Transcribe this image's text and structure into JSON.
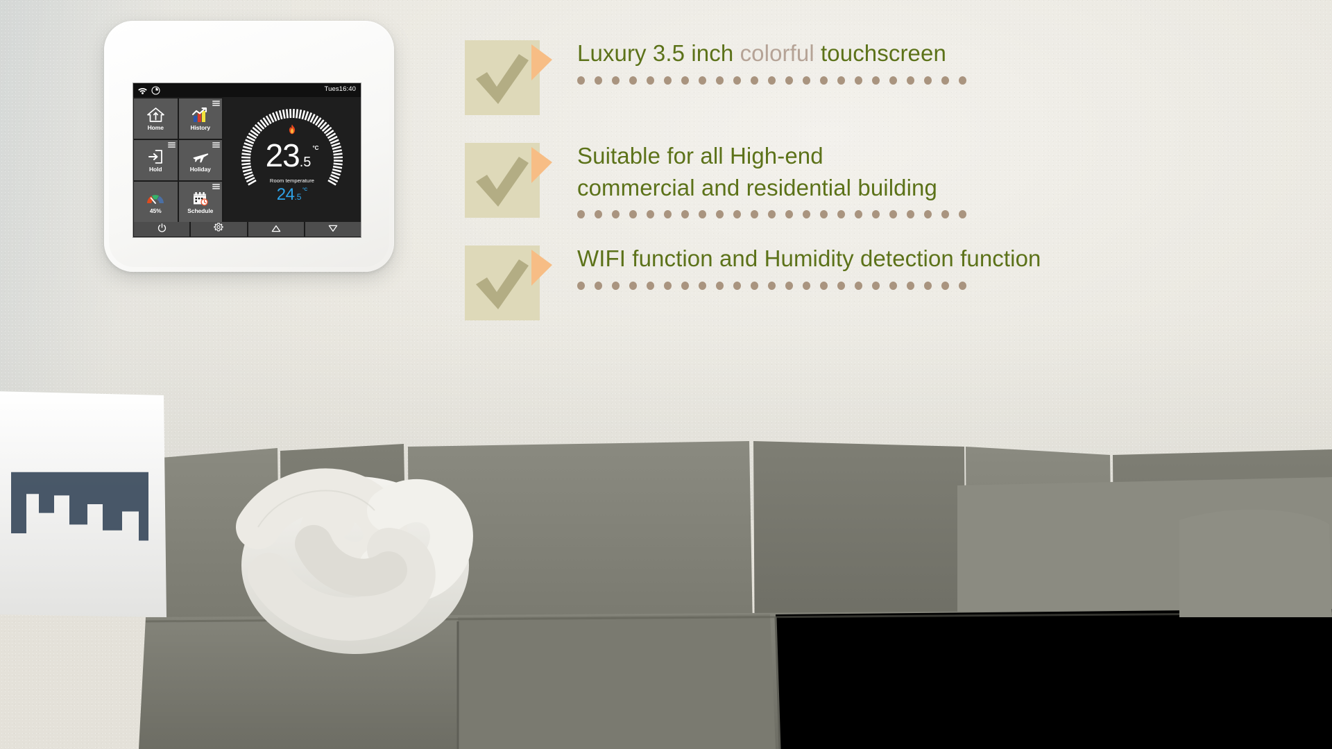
{
  "device": {
    "status_bar": {
      "wifi_icon": "wifi-icon",
      "clock_icon": "clock-icon",
      "time": "Tues16:40"
    },
    "tiles": [
      {
        "label": "Home",
        "icon": "house-arrow-icon",
        "has_menu": false
      },
      {
        "label": "History",
        "icon": "bar-chart-icon",
        "has_menu": true
      },
      {
        "label": "Hold",
        "icon": "login-arrow-icon",
        "has_menu": true
      },
      {
        "label": "Holiday",
        "icon": "airplane-icon",
        "has_menu": true
      },
      {
        "label": "45%",
        "icon": "humidity-gauge-icon",
        "has_menu": false
      },
      {
        "label": "Schedule",
        "icon": "calendar-clock-icon",
        "has_menu": true
      }
    ],
    "dial": {
      "flame_icon": "flame-icon",
      "room_temp_whole": "23",
      "room_temp_decimal": ".5",
      "room_temp_unit": "°C",
      "caption": "Room temperature",
      "set_temp_whole": "24",
      "set_temp_decimal": ".5",
      "set_temp_unit": "°C",
      "set_temp_color": "#2ea3e8",
      "tick_count": 60
    },
    "bottom_buttons": [
      {
        "icon": "power-icon"
      },
      {
        "icon": "gear-icon"
      },
      {
        "icon": "triangle-up-icon"
      },
      {
        "icon": "triangle-down-icon"
      }
    ]
  },
  "features": [
    {
      "check_icon": "check-mark-icon",
      "text_before": "Luxury 3.5 inch ",
      "text_highlight": "colorful",
      "text_after": " touchscreen",
      "text_line2": "",
      "dot_count": 23
    },
    {
      "check_icon": "check-mark-icon",
      "text_before": "Suitable for all High-end",
      "text_highlight": "",
      "text_after": "",
      "text_line2": "commercial and residential building",
      "dot_count": 23
    },
    {
      "check_icon": "check-mark-icon",
      "text_before": "WIFI function and Humidity detection function",
      "text_highlight": "",
      "text_after": "",
      "text_line2": "",
      "dot_count": 23
    }
  ],
  "colors": {
    "feature_text": "#5c7219",
    "feature_muted": "#b5a396",
    "badge_paper": "#ded9b9",
    "badge_corner": "#f7bd85",
    "badge_check": "#b3ad84",
    "dot": "#a9947f",
    "screen_bg": "#1b1b1b",
    "tile_bg": "#585858"
  }
}
